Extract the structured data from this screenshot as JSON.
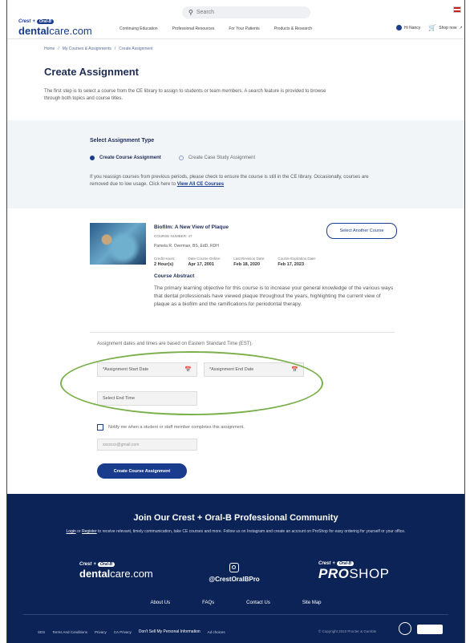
{
  "header": {
    "search_placeholder": "Search",
    "logo_brand_top": "Crest",
    "logo_brand_pill": "Oral-B",
    "logo_word_bold": "dental",
    "logo_word_rest": "care.com",
    "nav": [
      "Continuing Education",
      "Professional Resources",
      "For Your Patients",
      "Products & Research"
    ],
    "user_greeting": "Hi Nancy",
    "shop_label": "Shop now"
  },
  "breadcrumb": [
    "Home",
    "/",
    "My Courses & Assignments",
    "/",
    "Create Assignment"
  ],
  "page": {
    "title": "Create Assignment",
    "intro": "The first step is to select a course from the CE library to assign to students or team members. A search feature is provided to browse through both topics and course titles."
  },
  "assignment_type": {
    "title": "Select Assignment Type",
    "option1": "Create Course Assignment",
    "option2": "Create Case Study Assignment",
    "note": "If you reassign courses from previous periods, please check to ensure the course is still in the CE library. Occasionally, courses are removed due to low usage. Click here to",
    "note_link": "View All CE Courses"
  },
  "course": {
    "title": "Biofilm: A New View of Plaque",
    "number": "COURSE NUMBER: 47",
    "author": "Pamela R. Overman, BS, EdD, RDH",
    "meta": [
      {
        "label": "Credit Hours:",
        "value": "2 Hour(s)"
      },
      {
        "label": "Date Course Online:",
        "value": "Apr 17, 2001"
      },
      {
        "label": "Last Revision Date:",
        "value": "Feb 18, 2020"
      },
      {
        "label": "Course Expiration Date:",
        "value": "Feb 17, 2023"
      }
    ],
    "abstract_title": "Course Abstract",
    "abstract": "The primary learning objective for this course is to increase your general knowledge of the various ways that dental professionals have viewed plaque throughout the years, highlighting the current view of plaque as a biofilm and the ramifications for periodontal therapy.",
    "select_another": "Select Another Course"
  },
  "form": {
    "tz_note": "Assignment dates and times are based on Eastern Standard Time (EST).",
    "start_date": "*Assignment Start Date",
    "end_date": "*Assignment End Date",
    "end_time": "Select End Time",
    "notify_label": "Notify me when a student or staff member completes this assignment.",
    "email_value": "xxxxxxx@gmail.com",
    "submit": "Create Course Assignment"
  },
  "footer": {
    "title": "Join Our Crest + Oral-B Professional Community",
    "login": "Login",
    "or": "or",
    "register": "Register",
    "text": "to receive relevant, timely communication, take CE courses and more. Follow us on Instagram and create an account on ProShop for easy ordering for yourself or your office.",
    "instagram": "@CrestOralBPro",
    "proshop_bold": "PRO",
    "proshop_rest": "SHOP",
    "links": [
      "About Us",
      "FAQs",
      "Contact Us",
      "Site Map"
    ],
    "legal": [
      "SDS",
      "Terms And Conditions",
      "Privacy",
      "CA Privacy",
      "Don't Sell My Personal Information",
      "Ad choices"
    ],
    "copyright": "© Copyright 2022 Procter & Gamble"
  },
  "colors": {
    "brand": "#1a3c8c",
    "footer_bg": "#0b2356",
    "annotation": "#7ab04a"
  }
}
